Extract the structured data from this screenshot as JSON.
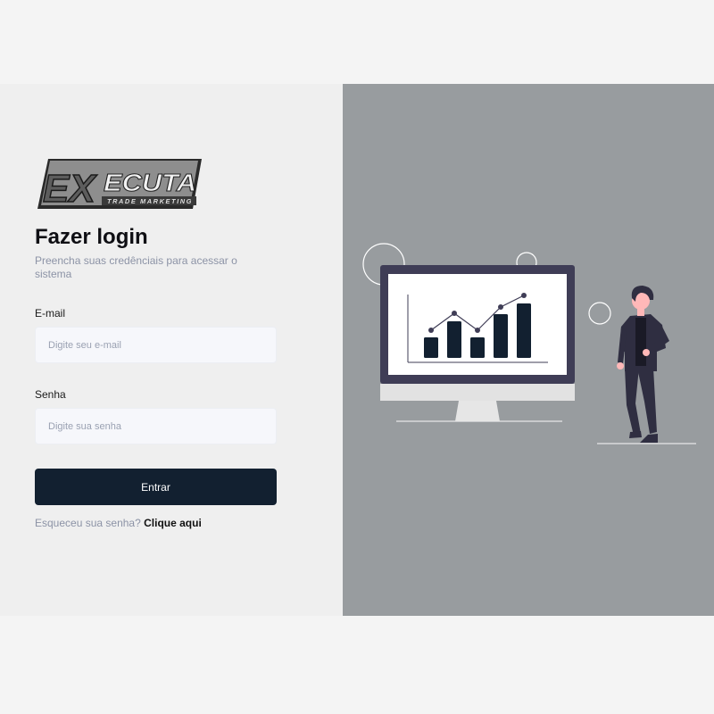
{
  "login": {
    "title": "Fazer login",
    "subtitle": "Preencha suas credênciais para acessar o sistema",
    "email_label": "E-mail",
    "email_placeholder": "Digite seu e-mail",
    "password_label": "Senha",
    "password_placeholder": "Digite sua senha",
    "submit_label": "Entrar",
    "forgot_text": "Esqueceu sua senha?",
    "forgot_link": "Clique aqui"
  },
  "logo": {
    "text": "EXECUTA",
    "tagline": "TRADE MARKETING"
  },
  "colors": {
    "button": "#122030",
    "left_bg": "#efefef",
    "right_bg": "#989c9f",
    "muted_text": "#8c93a6"
  }
}
